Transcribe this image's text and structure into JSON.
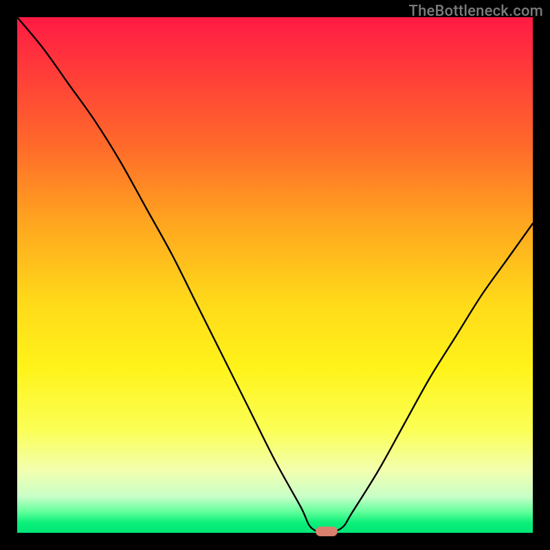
{
  "watermark": "TheBottleneck.com",
  "chart_data": {
    "type": "line",
    "title": "",
    "xlabel": "",
    "ylabel": "",
    "xlim": [
      0,
      100
    ],
    "ylim": [
      0,
      100
    ],
    "grid": false,
    "x": [
      0,
      5,
      10,
      15,
      20,
      25,
      30,
      35,
      40,
      45,
      50,
      55,
      57,
      60,
      63,
      65,
      70,
      75,
      80,
      85,
      90,
      95,
      100
    ],
    "values": [
      100,
      94,
      87,
      80,
      72,
      63,
      54,
      44,
      34,
      24,
      14,
      5,
      1,
      0,
      1,
      4,
      12,
      21,
      30,
      38,
      46,
      53,
      60
    ],
    "min_point": {
      "x": 60,
      "y": 0
    },
    "colors": {
      "curve": "#000000",
      "marker": "#d9806f",
      "gradient_top": "#ff1a44",
      "gradient_bottom": "#00e676"
    }
  }
}
